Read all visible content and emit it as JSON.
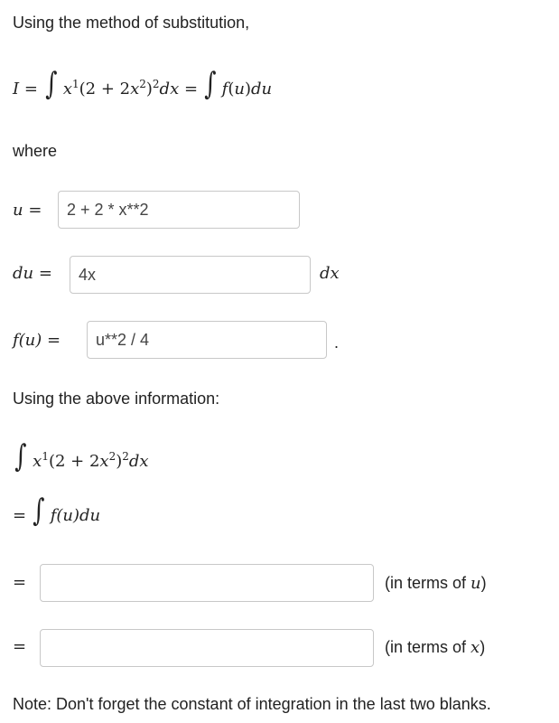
{
  "intro": "Using the method of substitution,",
  "where": "where",
  "inputs": {
    "u": "2 + 2 * x**2",
    "du": "4x",
    "fu": "u**2 / 4",
    "answer_u": "",
    "answer_x": ""
  },
  "labels": {
    "u_eq": "u =",
    "du_eq": "du =",
    "dx": "dx",
    "fu_eq": "f(u) =",
    "period": ".",
    "eq": "=",
    "fudu": "f(u)du",
    "in_terms_u_pre": "(in terms of ",
    "u_var": "u",
    "in_terms_x_pre": "(in terms of ",
    "x_var": "x",
    "close_paren": ")"
  },
  "above": "Using the above information:",
  "note": "Note: Don't forget the constant of integration in the last two blanks."
}
